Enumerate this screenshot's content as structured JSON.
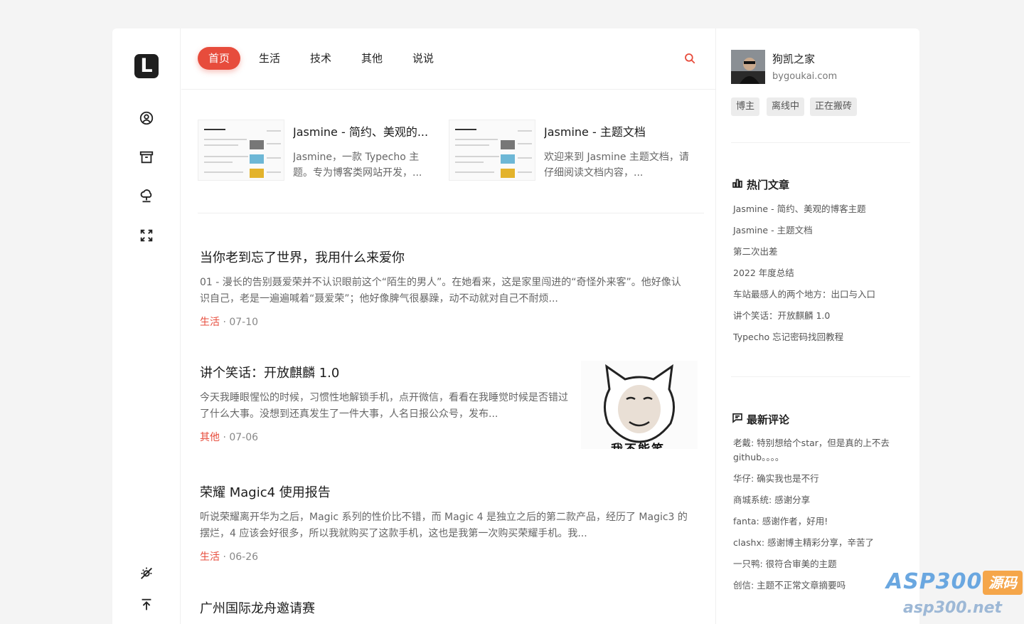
{
  "theme": {
    "accent": "#e74c3c",
    "bg": "#f4f4f4"
  },
  "sidebar": {
    "logo_letter": "L",
    "icons": [
      "user-circle-icon",
      "archive-icon",
      "cloud-link-icon",
      "shuffle-icon",
      "sun-off-icon",
      "back-to-top-icon"
    ]
  },
  "nav": {
    "items": [
      {
        "label": "首页",
        "active": true
      },
      {
        "label": "生活",
        "active": false
      },
      {
        "label": "技术",
        "active": false
      },
      {
        "label": "其他",
        "active": false
      },
      {
        "label": "说说",
        "active": false
      }
    ],
    "search_icon": "search-icon"
  },
  "featured": [
    {
      "title": "Jasmine - 简约、美观的...",
      "desc": "Jasmine，一款 Typecho 主题。专为博客类网站开发，..."
    },
    {
      "title": "Jasmine - 主题文档",
      "desc": "欢迎来到 Jasmine 主题文档，请仔细阅读文档内容，..."
    }
  ],
  "posts": [
    {
      "title": "当你老到忘了世界，我用什么来爱你",
      "excerpt": "01 - 漫长的告别聂爱荣并不认识眼前这个“陌生的男人”。在她看来，这是家里闯进的“奇怪外来客”。他好像认识自己，老是一遍遍喊着“聂爱荣”；他好像脾气很暴躁，动不动就对自己不耐烦...",
      "category": "生活",
      "date": "· 07-10"
    },
    {
      "title": "讲个笑话：开放麒麟 1.0",
      "excerpt": "今天我睡眼惺忪的时候，习惯性地解锁手机，点开微信，看看在我睡觉时候是否错过了什么大事。没想到还真发生了一件大事，人名日报公众号，发布...",
      "category": "其他",
      "date": "· 07-06",
      "thumb_caption": "我不能笑"
    },
    {
      "title": "荣耀 Magic4 使用报告",
      "excerpt": "听说荣耀离开华为之后，Magic 系列的性价比不错，而 Magic 4 是独立之后的第二款产品，经历了 Magic3 的摆烂，4 应该会好很多，所以我就购买了这款手机，这也是我第一次购买荣耀手机。我...",
      "category": "生活",
      "date": "· 06-26"
    },
    {
      "title": "广州国际龙舟邀请赛"
    }
  ],
  "author": {
    "name": "狗凯之家",
    "site": "bygoukai.com",
    "badges": [
      "博主",
      "离线中",
      "正在搬砖"
    ]
  },
  "hot": {
    "heading": "热门文章",
    "items": [
      "Jasmine - 简约、美观的博客主题",
      "Jasmine - 主题文档",
      "第二次出差",
      "2022 年度总结",
      "车站最感人的两个地方：出口与入口",
      "讲个笑话：开放麒麟 1.0",
      "Typecho 忘记密码找回教程"
    ]
  },
  "comments": {
    "heading": "最新评论",
    "items": [
      "老戴: 特别想给个star，但是真的上不去github。。。。",
      "华仔: 确实我也是不行",
      "商城系统: 感谢分享",
      "fanta: 感谢作者，好用!",
      "clashx: 感谢博主精彩分享，辛苦了",
      "一只鸭: 很符合审美的主题",
      "创信: 主题不正常文章摘要吗"
    ]
  },
  "watermark": {
    "brand": "ASP300",
    "tag": "源码",
    "url": "asp300.net"
  }
}
